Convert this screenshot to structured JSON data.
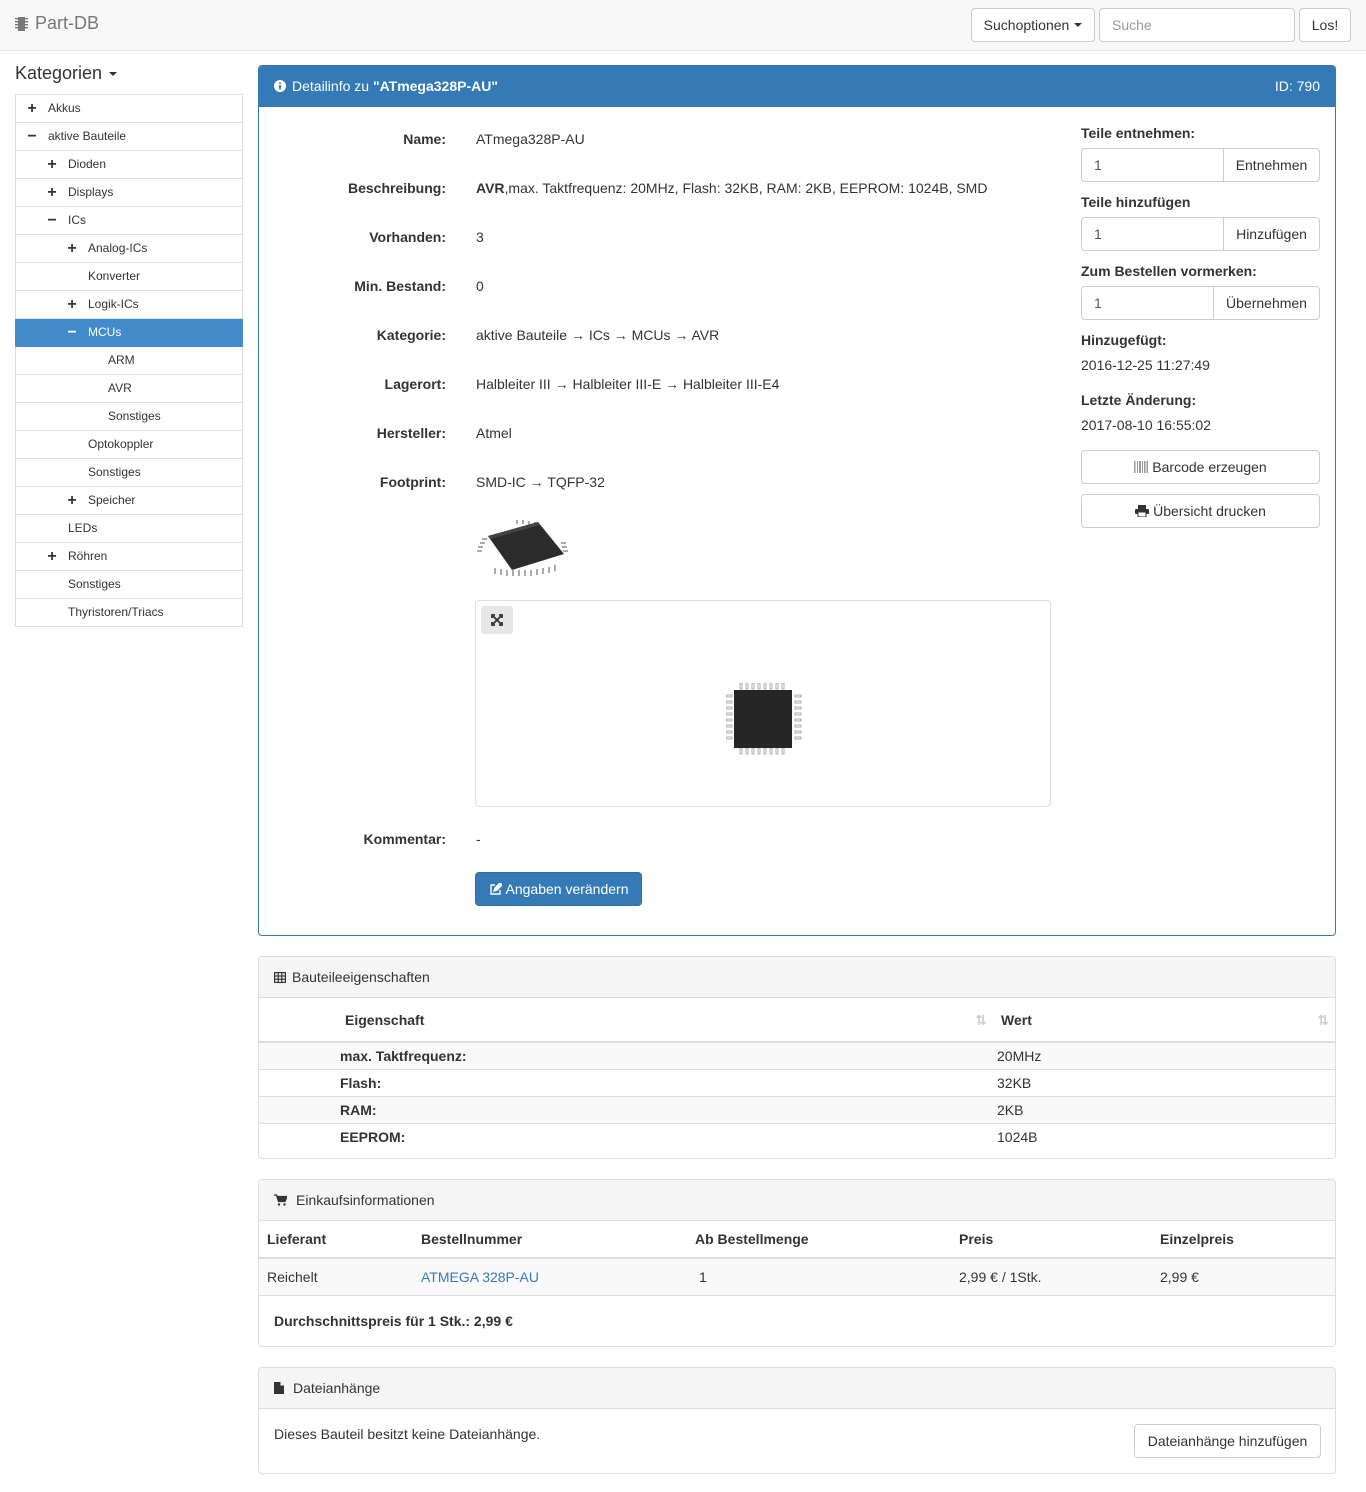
{
  "navbar": {
    "brand": "Part-DB",
    "search_options_label": "Suchoptionen",
    "search_placeholder": "Suche",
    "search_value": "",
    "search_go_label": "Los!"
  },
  "sidebar": {
    "title": "Kategorien",
    "items": [
      {
        "label": "Akkus",
        "toggle": "+"
      },
      {
        "label": "aktive Bauteile",
        "toggle": "−"
      },
      {
        "label": "Dioden",
        "toggle": "+"
      },
      {
        "label": "Displays",
        "toggle": "+"
      },
      {
        "label": "ICs",
        "toggle": "−"
      },
      {
        "label": "Analog-ICs",
        "toggle": "+"
      },
      {
        "label": "Konverter",
        "toggle": ""
      },
      {
        "label": "Logik-ICs",
        "toggle": "+"
      },
      {
        "label": "MCUs",
        "toggle": "−"
      },
      {
        "label": "ARM",
        "toggle": ""
      },
      {
        "label": "AVR",
        "toggle": ""
      },
      {
        "label": "Sonstiges",
        "toggle": ""
      },
      {
        "label": "Optokoppler",
        "toggle": ""
      },
      {
        "label": "Sonstiges",
        "toggle": ""
      },
      {
        "label": "Speicher",
        "toggle": "+"
      },
      {
        "label": "LEDs",
        "toggle": ""
      },
      {
        "label": "Röhren",
        "toggle": "+"
      },
      {
        "label": "Sonstiges",
        "toggle": ""
      },
      {
        "label": "Thyristoren/Triacs",
        "toggle": ""
      }
    ]
  },
  "detail": {
    "heading_prefix": "Detailinfo zu",
    "heading_part": "\"ATmega328P-AU\"",
    "heading_id": "ID: 790",
    "name_label": "Name:",
    "name_value": "ATmega328P-AU",
    "desc_label": "Beschreibung:",
    "desc_bold": "AVR",
    "desc_rest": ",max. Taktfrequenz: 20MHz, Flash: 32KB, RAM: 2KB, EEPROM: 1024B, SMD",
    "stock_label": "Vorhanden:",
    "stock_value": "3",
    "min_label": "Min. Bestand:",
    "min_value": "0",
    "category_label": "Kategorie:",
    "category_value": "aktive Bauteile → ICs → MCUs → AVR",
    "storage_label": "Lagerort:",
    "storage_value": "Halbleiter III → Halbleiter III-E → Halbleiter III-E4",
    "manufacturer_label": "Hersteller:",
    "manufacturer_value": "Atmel",
    "footprint_label": "Footprint:",
    "footprint_value": "SMD-IC → TQFP-32",
    "comment_label": "Kommentar:",
    "comment_value": "-",
    "edit_button": "Angaben verändern"
  },
  "actions": {
    "take_label": "Teile entnehmen:",
    "take_value": "1",
    "take_button": "Entnehmen",
    "add_label": "Teile hinzufügen",
    "add_value": "1",
    "add_button": "Hinzufügen",
    "order_label": "Zum Bestellen vormerken:",
    "order_value": "1",
    "order_button": "Übernehmen",
    "added_label": "Hinzugefügt:",
    "added_value": "2016-12-25 11:27:49",
    "changed_label": "Letzte Änderung:",
    "changed_value": "2017-08-10 16:55:02",
    "barcode_button": "Barcode erzeugen",
    "print_button": "Übersicht drucken"
  },
  "properties": {
    "heading": "Bauteileeigenschaften",
    "col_property": "Eigenschaft",
    "col_value": "Wert",
    "rows": [
      {
        "name": "max. Taktfrequenz:",
        "value": "20MHz"
      },
      {
        "name": "Flash:",
        "value": "32KB"
      },
      {
        "name": "RAM:",
        "value": "2KB"
      },
      {
        "name": "EEPROM:",
        "value": "1024B"
      }
    ]
  },
  "purchase": {
    "heading": "Einkaufsinformationen",
    "columns": [
      "Lieferant",
      "Bestellnummer",
      "Ab Bestellmenge",
      "Preis",
      "Einzelpreis"
    ],
    "rows": [
      {
        "supplier": "Reichelt",
        "order_no": "ATMEGA 328P-AU",
        "min_qty": "1",
        "price": "2,99 € / 1Stk.",
        "unit_price": "2,99 €"
      }
    ],
    "average": "Durchschnittspreis für 1 Stk.: 2,99 €"
  },
  "attachments": {
    "heading": "Dateianhänge",
    "empty_text": "Dieses Bauteil besitzt keine Dateianhänge.",
    "add_button": "Dateianhänge hinzufügen"
  },
  "colors": {
    "primary": "#337ab7",
    "active_tree": "#428bca",
    "border": "#dddddd"
  }
}
